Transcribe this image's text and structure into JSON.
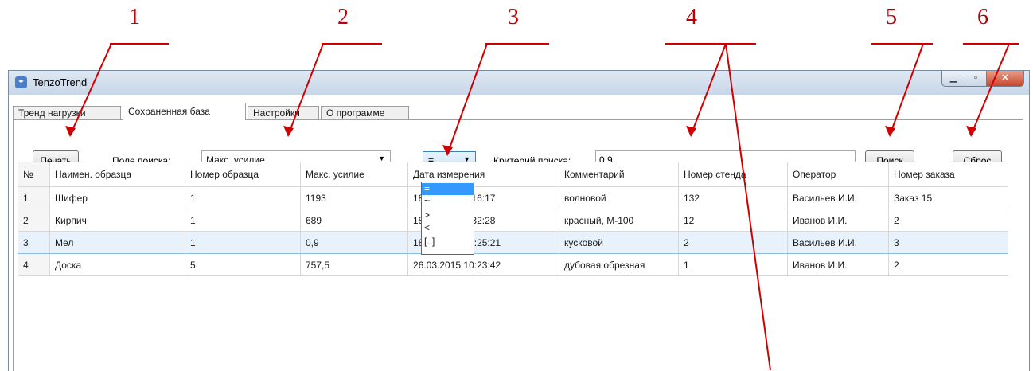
{
  "callouts": [
    "1",
    "2",
    "3",
    "4",
    "5",
    "6"
  ],
  "window": {
    "title": "TenzoTrend",
    "minimize_glyph": "▁",
    "maximize_glyph": "▫",
    "close_glyph": "✕"
  },
  "tabs": [
    {
      "label": "Тренд нагрузки"
    },
    {
      "label": "Сохраненная база"
    },
    {
      "label": "Настройки"
    },
    {
      "label": "О программе"
    }
  ],
  "toolbar": {
    "print_label": "Печать",
    "search_field_label": "Поле поиска:",
    "search_field_value": "Макс. усилие",
    "operator_value": "=",
    "operator_options": [
      "=",
      "~",
      ">",
      "<",
      "[..]"
    ],
    "criteria_label": "Критерий поиска:",
    "criteria_value": "0,9",
    "search_label": "Поиск",
    "reset_label": "Сброс"
  },
  "table": {
    "columns": [
      "№",
      "Наимен. образца",
      "Номер образца",
      "Макс. усилие",
      "Дата измерения",
      "Комментарий",
      "Номер стенда",
      "Оператор",
      "Номер заказа"
    ],
    "rows": [
      [
        "1",
        "Шифер",
        "1",
        "1193",
        "18.03.2015 9:16:17",
        "волновой",
        "132",
        "Васильев И.И.",
        "Заказ 15"
      ],
      [
        "2",
        "Кирпич",
        "1",
        "689",
        "18.03.2015 9:32:28",
        "красный, М-100",
        "12",
        "Иванов И.И.",
        "2"
      ],
      [
        "3",
        "Мел",
        "1",
        "0,9",
        "18.03.2015 14:25:21",
        "кусковой",
        "2",
        "Васильев И.И.",
        "3"
      ],
      [
        "4",
        "Доска",
        "5",
        "757,5",
        "26.03.2015 10:23:42",
        "дубовая обрезная",
        "1",
        "Иванов И.И.",
        "2"
      ]
    ],
    "selected_row_index": 2
  },
  "colors": {
    "callout": "#c00000",
    "selection": "#3399ff",
    "selected_row": "#e8f2fc"
  }
}
